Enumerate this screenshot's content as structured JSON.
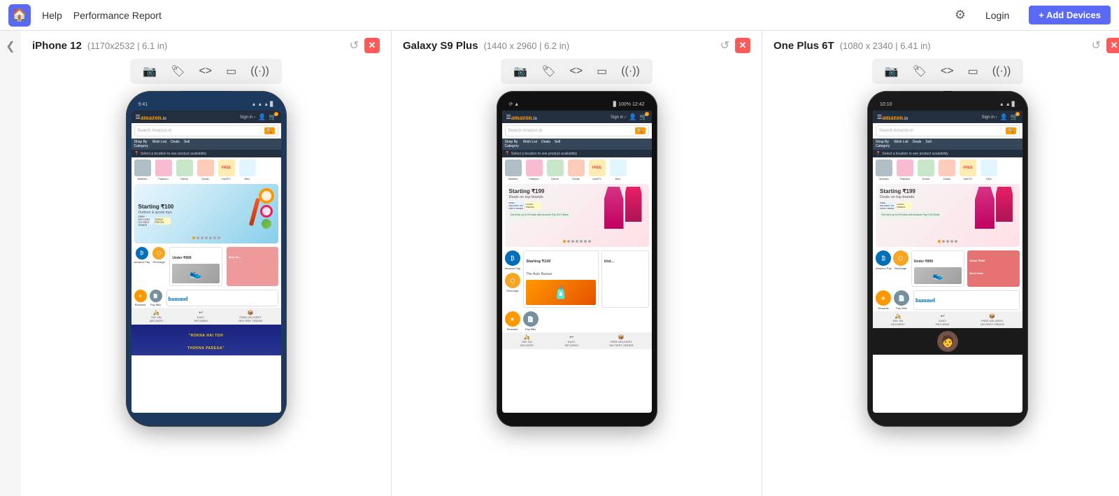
{
  "nav": {
    "logo": "🏠",
    "help": "Help",
    "title": "Performance Report",
    "gear": "⚙",
    "login": "Login",
    "add_devices": "+ Add Devices"
  },
  "sidebar": {
    "toggle": "❮"
  },
  "devices": [
    {
      "id": "iphone12",
      "name": "iPhone 12",
      "specs": "(1170x2532 | 6.1 in)",
      "type": "iphone",
      "toolbar": {
        "camera": "📷",
        "tag": "🏷",
        "code": "<>",
        "video": "▭",
        "wifi": "📶"
      },
      "amazon": {
        "sign_in": "Sign in ›",
        "search_placeholder": "Search Amazon.in",
        "nav_items": [
          "Shop By Category",
          "Wish List",
          "Deals",
          "Sell"
        ],
        "location_text": "Select a location to see product availability",
        "banner_title": "Starting ₹100",
        "banner_sub": "Outdoor & sports toys",
        "deal_title": "Under ₹899",
        "footer_items": [
          "PAY ON DELIVERY",
          "EASY RETURNS",
          "FREE DELIVERY ON FIRST ORDER"
        ],
        "movie_text": "\"ROKNA HAI TOH\nTHOKNA PADEGA\""
      }
    },
    {
      "id": "galaxys9plus",
      "name": "Galaxy S9 Plus",
      "specs": "(1440 x 2960 | 6.2 in)",
      "type": "galaxy",
      "toolbar": {
        "camera": "📷",
        "tag": "🏷",
        "code": "<>",
        "video": "▭",
        "wifi": "📶"
      },
      "amazon": {
        "sign_in": "Sign in ›",
        "search_placeholder": "Search Amazon.in",
        "nav_items": [
          "Shop By Category",
          "Wish List",
          "Deals",
          "Sell"
        ],
        "location_text": "Select a location to see product availability",
        "banner_title": "Starting ₹199",
        "banner_sub": "Deals on top brands",
        "deal_title": "Starting ₹149\nThe Auto Bazaar"
      }
    },
    {
      "id": "oneplus6t",
      "name": "One Plus 6T",
      "specs": "(1080 x 2340 | 6.41 in)",
      "type": "oneplus",
      "toolbar": {
        "camera": "📷",
        "tag": "🏷",
        "code": "<>",
        "video": "▭",
        "wifi": "📶"
      },
      "amazon": {
        "sign_in": "Sign in ›",
        "search_placeholder": "Search Amazon.in",
        "nav_items": [
          "Shop By Category",
          "Wish List",
          "Deals",
          "Sell"
        ],
        "location_text": "Select a location to see product availability",
        "banner_title": "Starting ₹199",
        "banner_sub": "Deals on top brands",
        "deal_title": "Under ₹899",
        "best_finds": "Under ₹499\nBest finds"
      }
    }
  ]
}
